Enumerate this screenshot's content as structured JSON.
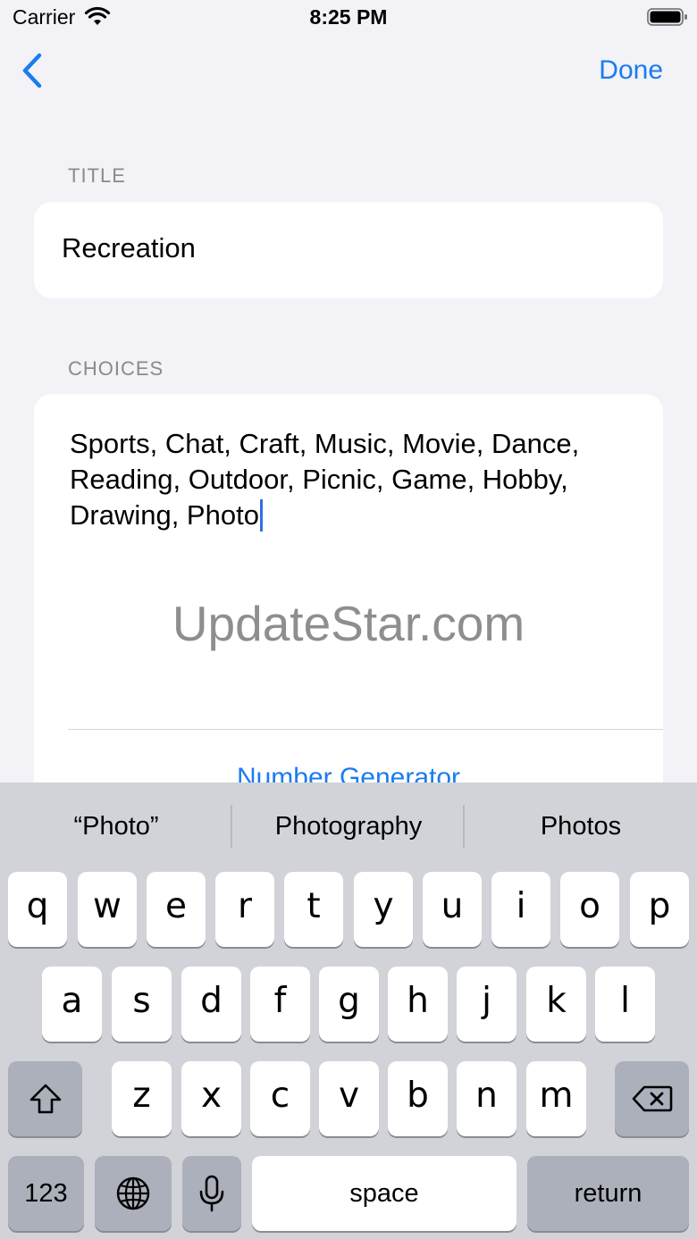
{
  "status_bar": {
    "carrier": "Carrier",
    "time": "8:25 PM"
  },
  "nav": {
    "done_label": "Done"
  },
  "title_section": {
    "header": "TITLE",
    "value": "Recreation"
  },
  "choices_section": {
    "header": "CHOICES",
    "value": "Sports, Chat, Craft, Music, Movie, Dance, Reading, Outdoor, Picnic, Game, Hobby, Drawing, Photo",
    "action_label": "Number Generator"
  },
  "watermark": "UpdateStar.com",
  "keyboard": {
    "suggestions": [
      "“Photo”",
      "Photography",
      "Photos"
    ],
    "row1": [
      "q",
      "w",
      "e",
      "r",
      "t",
      "y",
      "u",
      "i",
      "o",
      "p"
    ],
    "row2": [
      "a",
      "s",
      "d",
      "f",
      "g",
      "h",
      "j",
      "k",
      "l"
    ],
    "row3": [
      "z",
      "x",
      "c",
      "v",
      "b",
      "n",
      "m"
    ],
    "numbers_label": "123",
    "space_label": "space",
    "return_label": "return"
  },
  "colors": {
    "accent": "#1a7cf0",
    "background": "#f2f2f7",
    "keyboard_bg": "#d1d3d9"
  }
}
